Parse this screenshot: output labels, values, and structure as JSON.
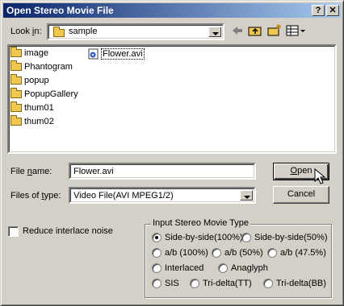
{
  "dialog": {
    "title": "Open Stereo Movie File",
    "help_button": "?",
    "close_button": "✕"
  },
  "look_in": {
    "label_prefix": "Look ",
    "label_hotkey": "i",
    "label_suffix": "n:",
    "value": "sample"
  },
  "toolbar": {
    "back_icon": "back-arrow-icon",
    "up_icon": "up-folder-icon",
    "new_folder_icon": "new-folder-icon",
    "view_menu_icon": "view-menu-icon"
  },
  "file_list": {
    "folders": [
      "image",
      "Phantogram",
      "popup",
      "PopupGallery",
      "thum01",
      "thum02"
    ],
    "files": [
      "Flower.avi"
    ]
  },
  "file_name": {
    "label_prefix": "File ",
    "label_hotkey": "n",
    "label_suffix": "ame:",
    "value": "Flower.avi"
  },
  "file_type": {
    "label_prefix": "Files of ",
    "label_hotkey": "t",
    "label_suffix": "ype:",
    "value": "Video File(AVI MPEG1/2)"
  },
  "buttons": {
    "open_hotkey": "O",
    "open_rest": "pen",
    "cancel": "Cancel"
  },
  "reduce_interlace": {
    "label": "Reduce interlace noise",
    "checked": false
  },
  "stereo_type": {
    "title": "Input Stereo Movie Type",
    "options": [
      "Side-by-side(100%)",
      "Side-by-side(50%)",
      "a/b (100%)",
      "a/b (50%)",
      "a/b (47.5%)",
      "Interlaced",
      "Anaglyph",
      "SIS",
      "Tri-delta(TT)",
      "Tri-delta(BB)"
    ],
    "selected": "Side-by-side(100%)"
  }
}
